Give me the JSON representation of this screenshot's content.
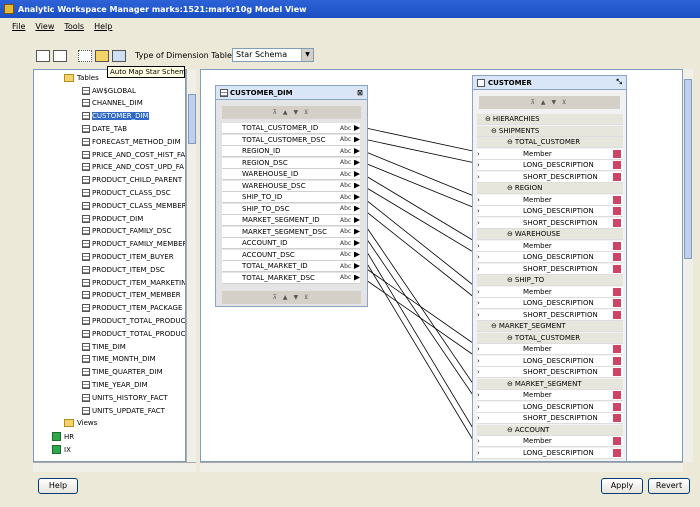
{
  "window": {
    "title": "Analytic Workspace Manager  marks:1521:markr10g  Model View"
  },
  "menu": [
    "File",
    "View",
    "Tools",
    "Help"
  ],
  "toolbar": {
    "type_label": "Type of Dimension Table(s):",
    "type_value": "Star Schema",
    "tooltip": "Auto Map Star Schema"
  },
  "tree": {
    "tables_label": "Tables",
    "tables": [
      "AW$GLOBAL",
      "CHANNEL_DIM",
      "CUSTOMER_DIM",
      "DATE_TAB",
      "FORECAST_METHOD_DIM",
      "PRICE_AND_COST_HIST_FA",
      "PRICE_AND_COST_UPD_FA",
      "PRODUCT_CHILD_PARENT",
      "PRODUCT_CLASS_DSC",
      "PRODUCT_CLASS_MEMBER",
      "PRODUCT_DIM",
      "PRODUCT_FAMILY_DSC",
      "PRODUCT_FAMILY_MEMBER",
      "PRODUCT_ITEM_BUYER",
      "PRODUCT_ITEM_DSC",
      "PRODUCT_ITEM_MARKETING",
      "PRODUCT_ITEM_MEMBER",
      "PRODUCT_ITEM_PACKAGE",
      "PRODUCT_TOTAL_PRODUCT",
      "PRODUCT_TOTAL_PRODUCT",
      "TIME_DIM",
      "TIME_MONTH_DIM",
      "TIME_QUARTER_DIM",
      "TIME_YEAR_DIM",
      "UNITS_HISTORY_FACT",
      "UNITS_UPDATE_FACT"
    ],
    "selected": "CUSTOMER_DIM",
    "views_label": "Views",
    "schemas": [
      "HR",
      "IX"
    ]
  },
  "dim_table": {
    "title": "CUSTOMER_DIM",
    "columns": [
      {
        "name": "TOTAL_CUSTOMER_ID",
        "type": "Abc"
      },
      {
        "name": "TOTAL_CUSTOMER_DSC",
        "type": "Abc"
      },
      {
        "name": "REGION_ID",
        "type": "Abc"
      },
      {
        "name": "REGION_DSC",
        "type": "Abc"
      },
      {
        "name": "WAREHOUSE_ID",
        "type": "Abc"
      },
      {
        "name": "WAREHOUSE_DSC",
        "type": "Abc"
      },
      {
        "name": "SHIP_TO_ID",
        "type": "Abc"
      },
      {
        "name": "SHIP_TO_DSC",
        "type": "Abc"
      },
      {
        "name": "MARKET_SEGMENT_ID",
        "type": "Abc"
      },
      {
        "name": "MARKET_SEGMENT_DSC",
        "type": "Abc"
      },
      {
        "name": "ACCOUNT_ID",
        "type": "Abc"
      },
      {
        "name": "ACCOUNT_DSC",
        "type": "Abc"
      },
      {
        "name": "TOTAL_MARKET_ID",
        "type": "Abc"
      },
      {
        "name": "TOTAL_MARKET_DSC",
        "type": "Abc"
      }
    ]
  },
  "cube": {
    "title": "CUSTOMER",
    "rows": [
      {
        "text": "HIERARCHIES",
        "kind": "hdr",
        "indent": 6
      },
      {
        "text": "SHIPMENTS",
        "kind": "hdr",
        "indent": 14
      },
      {
        "text": "TOTAL_CUSTOMER",
        "kind": "hdr",
        "indent": 30
      },
      {
        "text": "Member",
        "kind": "item",
        "indent": 46
      },
      {
        "text": "LONG_DESCRIPTION",
        "kind": "item",
        "indent": 46
      },
      {
        "text": "SHORT_DESCRIPTION",
        "kind": "item",
        "indent": 46
      },
      {
        "text": "REGION",
        "kind": "hdr",
        "indent": 30
      },
      {
        "text": "Member",
        "kind": "item",
        "indent": 46
      },
      {
        "text": "LONG_DESCRIPTION",
        "kind": "item",
        "indent": 46
      },
      {
        "text": "SHORT_DESCRIPTION",
        "kind": "item",
        "indent": 46
      },
      {
        "text": "WAREHOUSE",
        "kind": "hdr",
        "indent": 30
      },
      {
        "text": "Member",
        "kind": "item",
        "indent": 46
      },
      {
        "text": "LONG_DESCRIPTION",
        "kind": "item",
        "indent": 46
      },
      {
        "text": "SHORT_DESCRIPTION",
        "kind": "item",
        "indent": 46
      },
      {
        "text": "SHIP_TO",
        "kind": "hdr",
        "indent": 30
      },
      {
        "text": "Member",
        "kind": "item",
        "indent": 46
      },
      {
        "text": "LONG_DESCRIPTION",
        "kind": "item",
        "indent": 46
      },
      {
        "text": "SHORT_DESCRIPTION",
        "kind": "item",
        "indent": 46
      },
      {
        "text": "MARKET_SEGMENT",
        "kind": "hdr",
        "indent": 14
      },
      {
        "text": "TOTAL_CUSTOMER",
        "kind": "hdr",
        "indent": 30
      },
      {
        "text": "Member",
        "kind": "item",
        "indent": 46
      },
      {
        "text": "LONG_DESCRIPTION",
        "kind": "item",
        "indent": 46
      },
      {
        "text": "SHORT_DESCRIPTION",
        "kind": "item",
        "indent": 46
      },
      {
        "text": "MARKET_SEGMENT",
        "kind": "hdr",
        "indent": 30
      },
      {
        "text": "Member",
        "kind": "item",
        "indent": 46
      },
      {
        "text": "LONG_DESCRIPTION",
        "kind": "item",
        "indent": 46
      },
      {
        "text": "SHORT_DESCRIPTION",
        "kind": "item",
        "indent": 46
      },
      {
        "text": "ACCOUNT",
        "kind": "hdr",
        "indent": 30
      },
      {
        "text": "Member",
        "kind": "item",
        "indent": 46
      },
      {
        "text": "LONG_DESCRIPTION",
        "kind": "item",
        "indent": 46
      }
    ]
  },
  "buttons": {
    "help": "Help",
    "apply": "Apply",
    "revert": "Revert"
  }
}
